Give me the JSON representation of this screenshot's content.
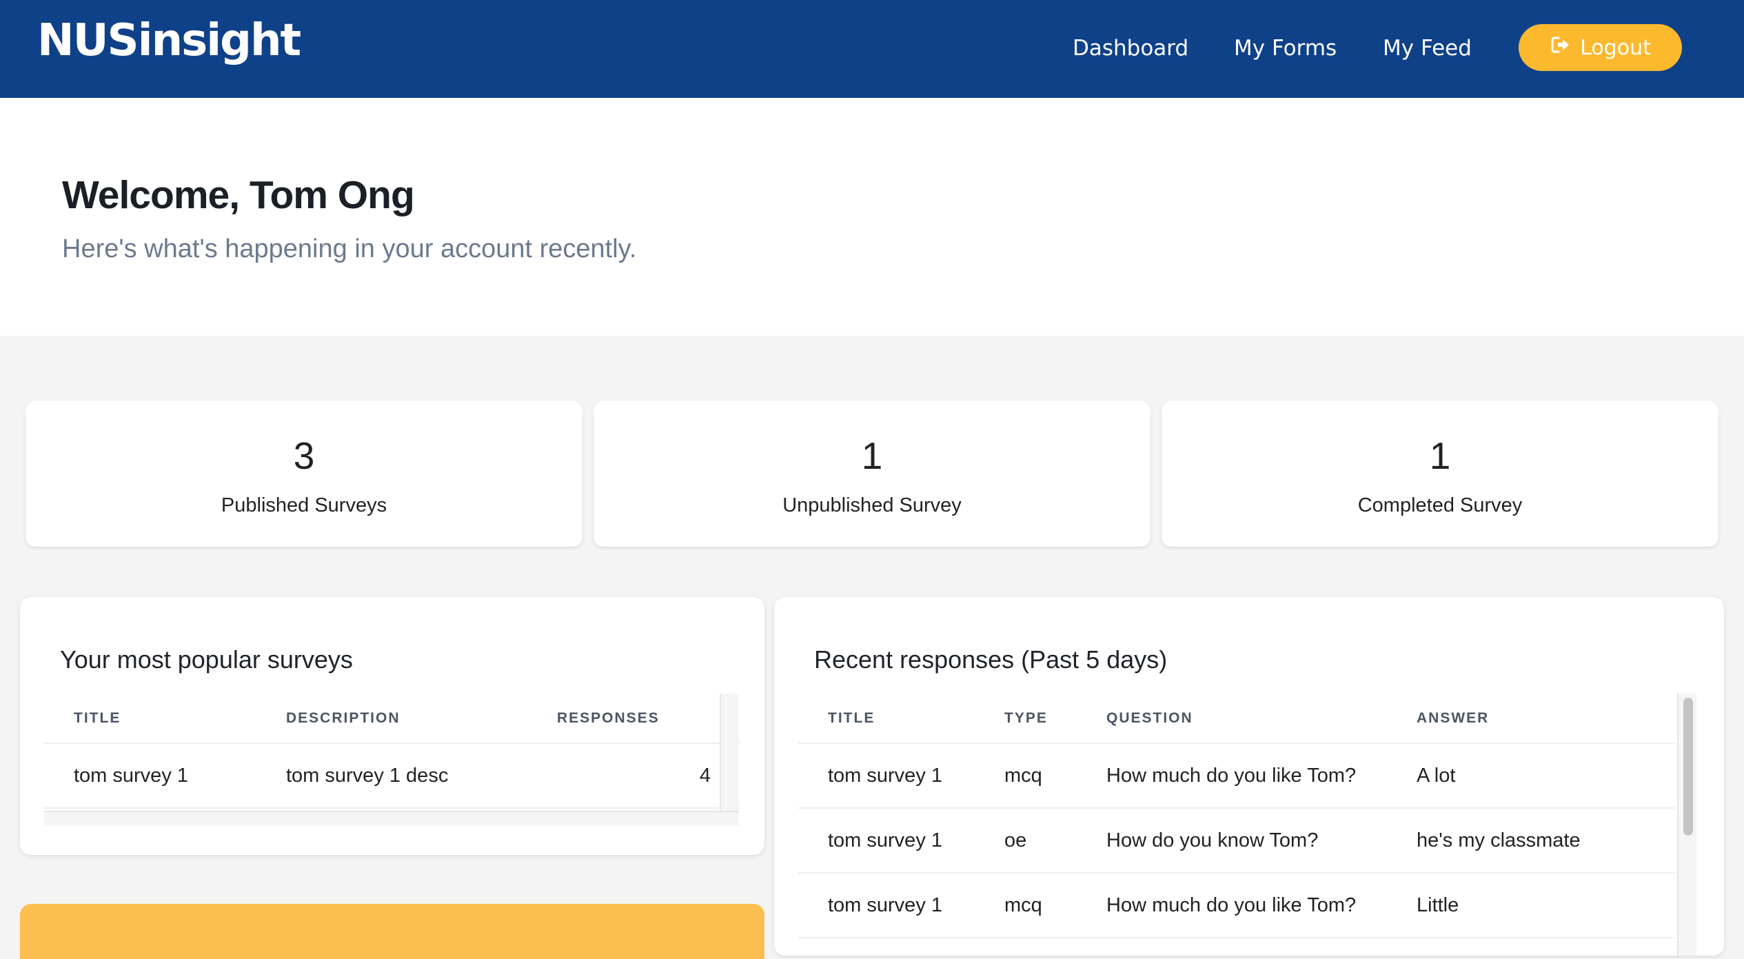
{
  "header": {
    "brand": "NUSinsight",
    "nav": [
      "Dashboard",
      "My Forms",
      "My Feed"
    ],
    "logout_label": "Logout",
    "colors": {
      "bar": "#0f4189",
      "logout": "#fdb92e"
    }
  },
  "hero": {
    "welcome": "Welcome, Tom Ong",
    "subtitle": "Here's what's happening in your account recently."
  },
  "stats": [
    {
      "value": "3",
      "label": "Published Surveys"
    },
    {
      "value": "1",
      "label": "Unpublished Survey"
    },
    {
      "value": "1",
      "label": "Completed Survey"
    }
  ],
  "popular": {
    "title": "Your most popular surveys",
    "columns": [
      "TITLE",
      "DESCRIPTION",
      "RESPONSES"
    ],
    "rows": [
      {
        "title": "tom survey 1",
        "description": "tom survey 1 desc",
        "responses": "4"
      }
    ]
  },
  "recent": {
    "title": "Recent responses (Past 5 days)",
    "columns": [
      "TITLE",
      "TYPE",
      "QUESTION",
      "ANSWER"
    ],
    "rows": [
      {
        "title": "tom survey 1",
        "type": "mcq",
        "question": "How much do you like Tom?",
        "answer": "A lot"
      },
      {
        "title": "tom survey 1",
        "type": "oe",
        "question": "How do you know Tom?",
        "answer": "he's my classmate"
      },
      {
        "title": "tom survey 1",
        "type": "mcq",
        "question": "How much do you like Tom?",
        "answer": "Little"
      }
    ]
  }
}
